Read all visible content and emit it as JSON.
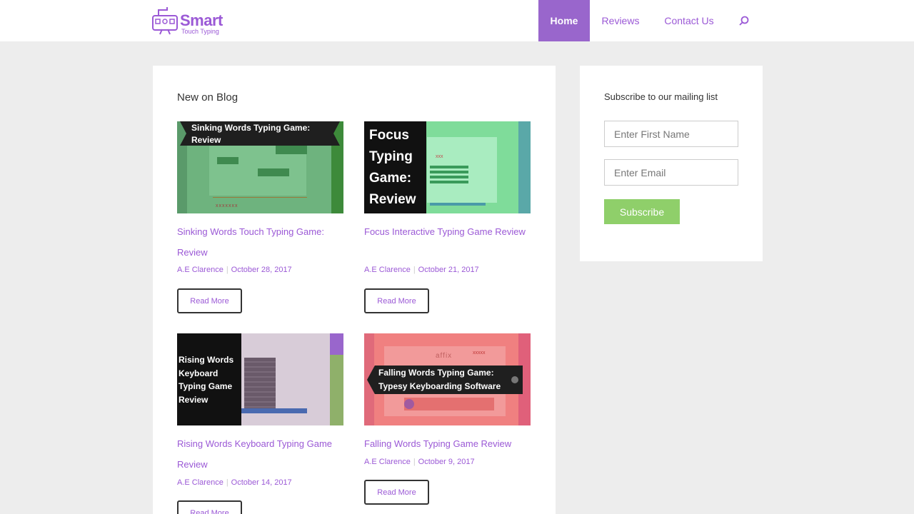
{
  "header": {
    "logo": {
      "name": "Smart",
      "tagline": "Touch Typing"
    },
    "nav": [
      {
        "label": "Home",
        "active": true
      },
      {
        "label": "Reviews"
      },
      {
        "label": "Contact Us"
      }
    ],
    "search_icon": "search-icon"
  },
  "main": {
    "title": "New on Blog",
    "posts": [
      {
        "thumb_text": "Sinking Words Typing Game: Review",
        "title": "Sinking Words Touch Typing Game: Review",
        "author": "A.E Clarence",
        "date": "October 28, 2017",
        "read_more": "Read More"
      },
      {
        "thumb_text": "Focus Typing Game: Review",
        "title": "Focus Interactive Typing Game Review",
        "author": "A.E Clarence",
        "date": "October 21, 2017",
        "read_more": "Read More"
      },
      {
        "thumb_text": "Rising Words Keyboard Typing Game Review",
        "title": "Rising Words Keyboard Typing Game Review",
        "author": "A.E Clarence",
        "date": "October 14, 2017",
        "read_more": "Read More"
      },
      {
        "thumb_text": "Falling Words Typing Game: Typesy Keyboarding Software",
        "title": "Falling Words Typing Game Review",
        "author": "A.E Clarence",
        "date": "October 9, 2017",
        "read_more": "Read More"
      }
    ]
  },
  "sidebar": {
    "title": "Subscribe to our mailing list",
    "first_name_placeholder": "Enter First Name",
    "email_placeholder": "Enter Email",
    "subscribe_label": "Subscribe"
  },
  "colors": {
    "accent": "#9b59d6",
    "nav_active_bg": "#9966cc",
    "subscribe_bg": "#8fcf6a"
  }
}
